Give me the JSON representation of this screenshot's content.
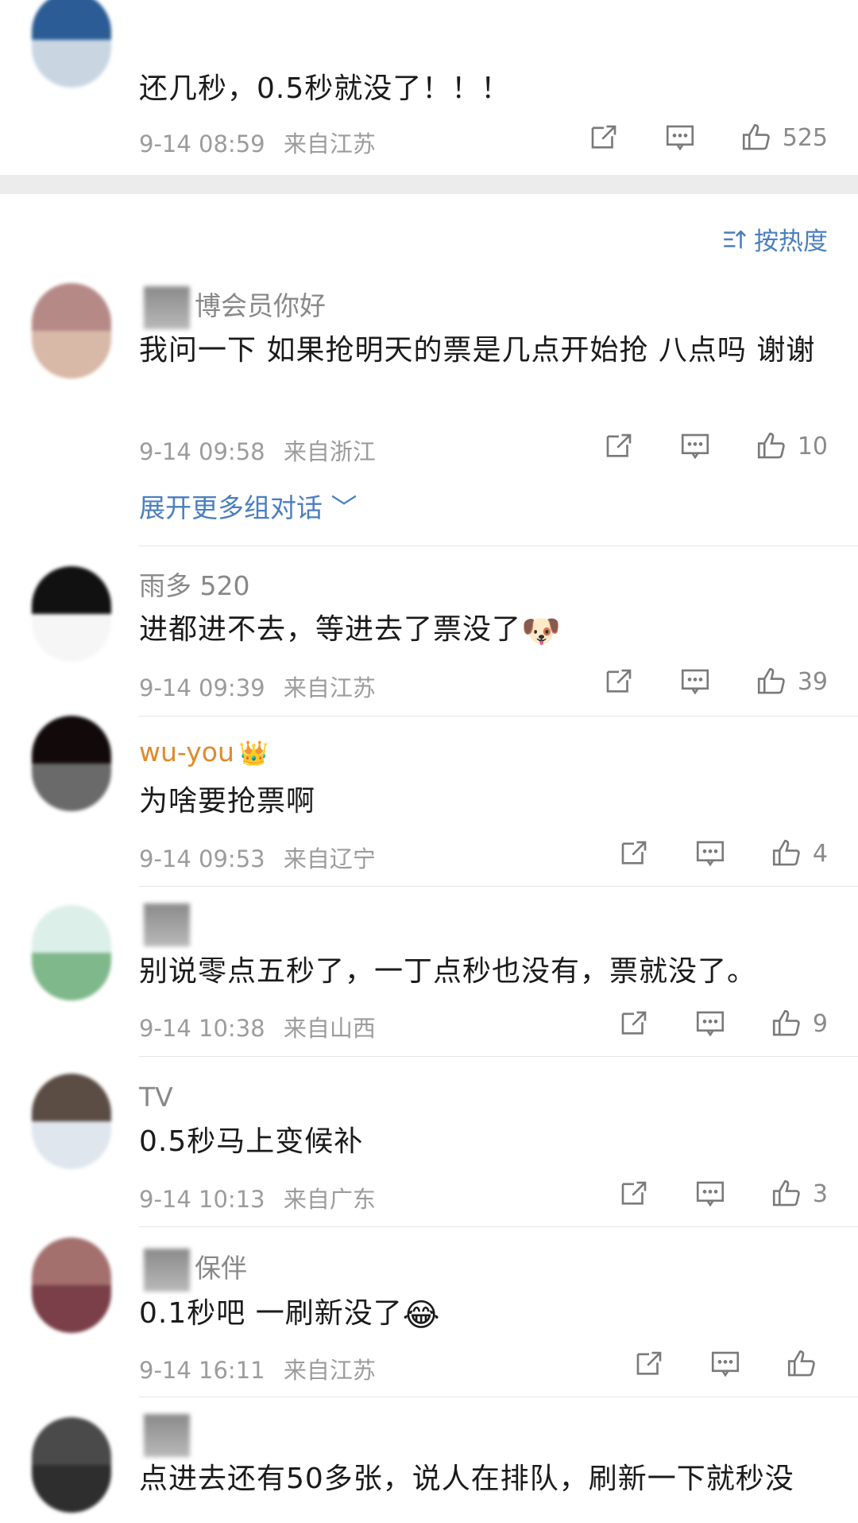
{
  "sort": {
    "label": "按热度"
  },
  "expand_more": {
    "label": "展开更多组对话"
  },
  "expand_chevron": "﹀",
  "top_comment": {
    "text": "还几秒，0.5秒就没了！！！",
    "date": "9-14 08:59",
    "location": "来自江苏",
    "likes": "525"
  },
  "comments": [
    {
      "name_suffix": "博会员你好",
      "text": "我问一下 如果抢明天的票是几点开始抢 八点吗 谢谢",
      "date": "9-14 09:58",
      "location": "来自浙江",
      "likes": "10"
    },
    {
      "name_suffix": "雨多 520",
      "text": "进都进不去，等进去了票没了",
      "date": "9-14 09:39",
      "location": "来自江苏",
      "likes": "39"
    },
    {
      "name_suffix": "wu-you",
      "text": "为啥要抢票啊",
      "date": "9-14 09:53",
      "location": "来自辽宁",
      "likes": "4"
    },
    {
      "name_suffix": "",
      "text": "别说零点五秒了，一丁点秒也没有，票就没了。",
      "date": "9-14 10:38",
      "location": "来自山西",
      "likes": "9"
    },
    {
      "name_suffix": "TV",
      "text": "0.5秒马上变候补",
      "date": "9-14 10:13",
      "location": "来自广东",
      "likes": "3"
    },
    {
      "name_suffix": "保伴",
      "text": "0.1秒吧 一刷新没了",
      "date": "9-14 16:11",
      "location": "来自江苏",
      "likes": ""
    },
    {
      "name_suffix": "",
      "text": "点进去还有50多张，说人在排队，刷新一下就秒没",
      "date": "",
      "location": "",
      "likes": ""
    }
  ],
  "emojis": {
    "doge": "🐶",
    "crown": "👑",
    "laugh_cry": "😂"
  },
  "colors": {
    "link": "#4a7fbf",
    "meta": "#9c9c9c",
    "divider": "#ececec"
  }
}
